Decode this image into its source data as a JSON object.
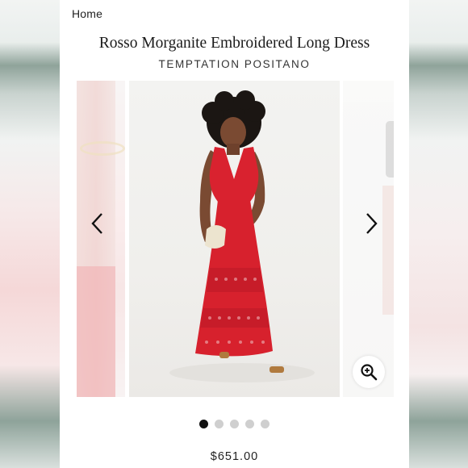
{
  "header": {
    "home_link": "Home"
  },
  "product": {
    "title": "Rosso Morganite Embroidered Long Dress",
    "brand": "TEMPTATION POSITANO",
    "price": "$651.00"
  },
  "gallery": {
    "image_count": 5,
    "active_index": 0,
    "icons": {
      "prev": "chevron-left-icon",
      "next": "chevron-right-icon",
      "zoom": "zoom-in-icon"
    }
  },
  "colors": {
    "dress_red": "#d9222f",
    "active_dot": "#111111",
    "inactive_dot": "#cfcfcf"
  }
}
